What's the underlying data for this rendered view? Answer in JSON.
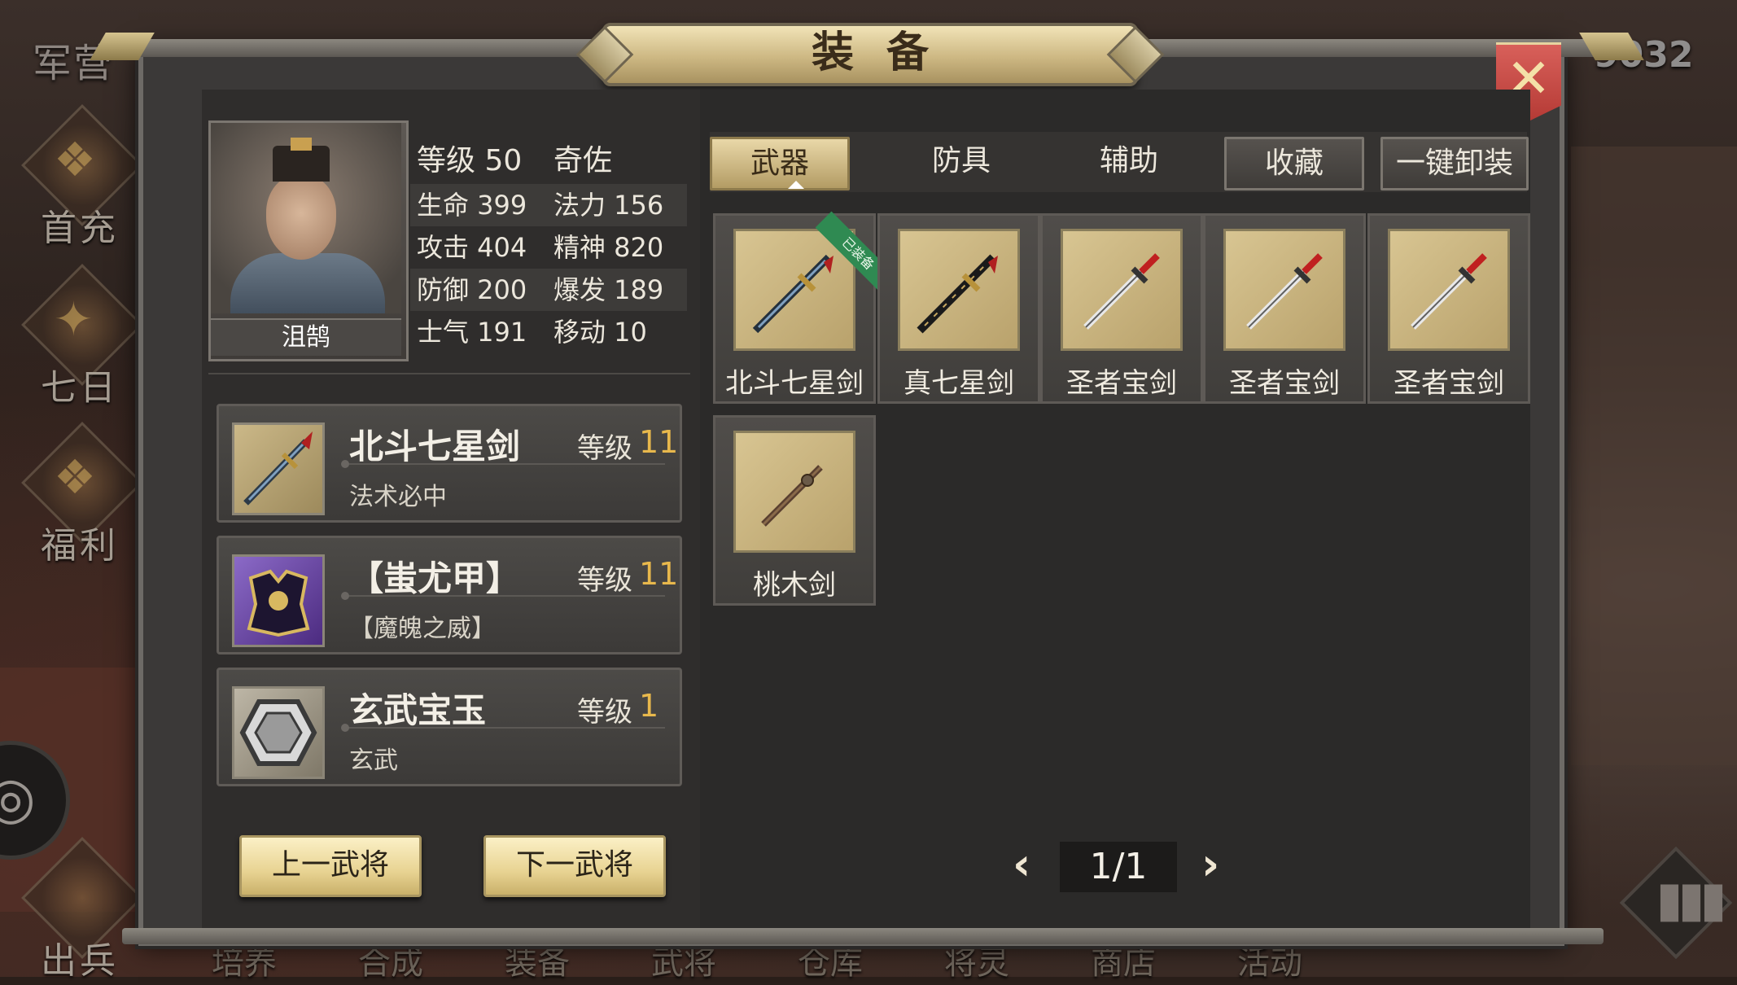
{
  "background": {
    "top_left_label": "军营",
    "top_right_number": "9032",
    "side_buttons": [
      {
        "label": "首充",
        "icon": "gift-box-icon"
      },
      {
        "label": "七日",
        "icon": "scroll-icon"
      },
      {
        "label": "福利",
        "icon": "treasure-chest-icon"
      },
      {
        "label": "出兵",
        "icon": "drum-icon"
      }
    ],
    "bottom_nav": [
      "培养",
      "合成",
      "装备",
      "武将",
      "仓库",
      "将灵",
      "商店",
      "活动"
    ]
  },
  "panel": {
    "title": "装备",
    "close_icon": "close-icon"
  },
  "hero": {
    "name": "沮鹄",
    "stats": [
      [
        "等级 50",
        "奇佐"
      ],
      [
        "生命 399",
        "法力 156"
      ],
      [
        "攻击 404",
        "精神 820"
      ],
      [
        "防御 200",
        "爆发 189"
      ],
      [
        "士气 191",
        "移动 10"
      ]
    ]
  },
  "equipped": [
    {
      "name": "北斗七星剑",
      "level_label": "等级",
      "level": "11",
      "desc": "法术必中",
      "icon": "sword-icon"
    },
    {
      "name": "【蚩尤甲】",
      "level_label": "等级",
      "level": "11",
      "desc": "【魔魄之威】",
      "icon": "armor-icon"
    },
    {
      "name": "玄武宝玉",
      "level_label": "等级",
      "level": "1",
      "desc": "玄武",
      "icon": "gem-icon"
    }
  ],
  "buttons": {
    "prev": "上一武将",
    "next": "下一武将"
  },
  "tabs": [
    "武器",
    "防具",
    "辅助",
    "收藏",
    "一键卸装"
  ],
  "active_tab": "武器",
  "inventory": [
    {
      "name": "北斗七星剑",
      "badge": "已装备",
      "icon": "sword-icon"
    },
    {
      "name": "真七星剑",
      "icon": "sword-icon"
    },
    {
      "name": "圣者宝剑",
      "icon": "sword-icon"
    },
    {
      "name": "圣者宝剑",
      "icon": "sword-icon"
    },
    {
      "name": "圣者宝剑",
      "icon": "sword-icon"
    },
    {
      "name": "桃木剑",
      "icon": "wooden-sword-icon"
    }
  ],
  "pager": {
    "text": "1/1",
    "prev": "‹",
    "next": "›"
  },
  "colors": {
    "gold_accent": "#e8b84c",
    "panel_bg": "#3b3938",
    "close_red": "#c8453f",
    "equipped_ribbon": "#2f8a52"
  }
}
